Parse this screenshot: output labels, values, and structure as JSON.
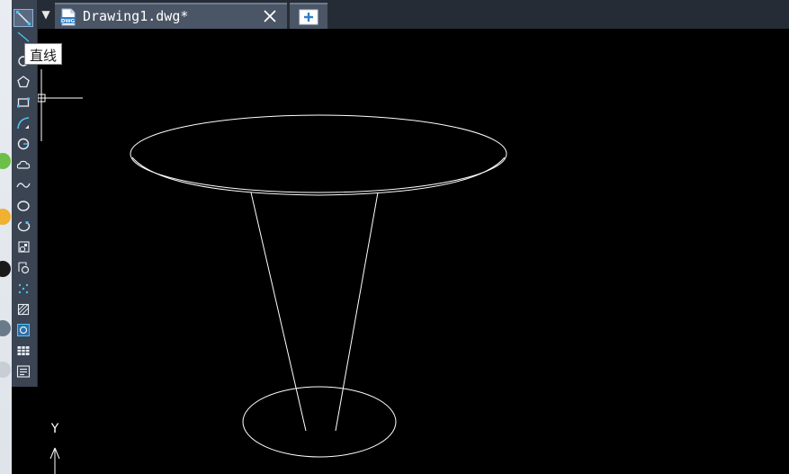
{
  "window": {
    "active_tab_title": "Drawing1.dwg*",
    "tab_menu_glyph": "▼"
  },
  "tooltip": {
    "text": "直线"
  },
  "toolbar": {
    "tools": [
      {
        "name": "line-tool",
        "icon": "line-icon"
      },
      {
        "name": "construction-line-tool",
        "icon": "construction-line-icon"
      },
      {
        "name": "polyline-tool",
        "icon": "polyline-icon"
      },
      {
        "name": "polygon-tool",
        "icon": "polygon-icon"
      },
      {
        "name": "rectangle-tool",
        "icon": "rectangle-icon"
      },
      {
        "name": "arc-tool",
        "icon": "arc-icon"
      },
      {
        "name": "circle-tool",
        "icon": "circle-icon"
      },
      {
        "name": "revision-cloud-tool",
        "icon": "cloud-icon"
      },
      {
        "name": "spline-tool",
        "icon": "spline-icon"
      },
      {
        "name": "ellipse-tool",
        "icon": "ellipse-icon"
      },
      {
        "name": "ellipse-arc-tool",
        "icon": "ellipse-arc-icon"
      },
      {
        "name": "insert-block-tool",
        "icon": "insert-block-icon"
      },
      {
        "name": "make-block-tool",
        "icon": "make-block-icon"
      },
      {
        "name": "point-tool",
        "icon": "point-icon"
      },
      {
        "name": "hatch-tool",
        "icon": "hatch-icon"
      },
      {
        "name": "region-tool",
        "icon": "region-icon"
      },
      {
        "name": "table-tool",
        "icon": "table-icon"
      },
      {
        "name": "multiline-text-tool",
        "icon": "mtext-icon"
      }
    ]
  },
  "ucs": {
    "y_label": "Y"
  },
  "colors": {
    "canvas": "#000000",
    "toolbar": "#3b4453",
    "tab_active": "#4a5566",
    "accent": "#4fc3f7",
    "drawing_lines": "#ffffff"
  }
}
